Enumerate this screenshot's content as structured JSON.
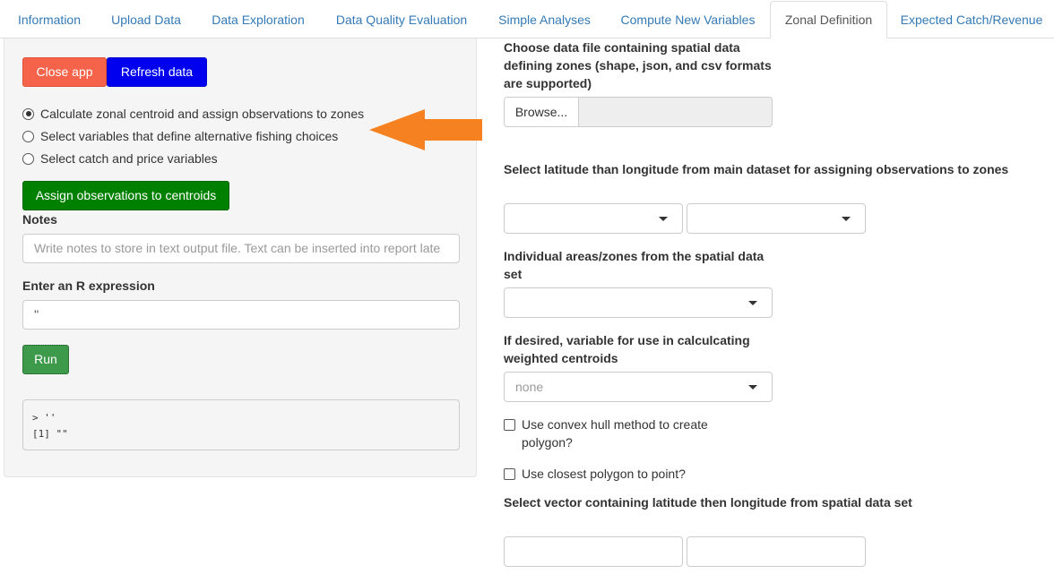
{
  "tabs": [
    {
      "label": "Information"
    },
    {
      "label": "Upload Data"
    },
    {
      "label": "Data Exploration"
    },
    {
      "label": "Data Quality Evaluation"
    },
    {
      "label": "Simple Analyses"
    },
    {
      "label": "Compute New Variables"
    },
    {
      "label": "Zonal Definition",
      "active": true
    },
    {
      "label": "Expected Catch/Revenue"
    }
  ],
  "sidebar": {
    "close_label": "Close app",
    "refresh_label": "Refresh data",
    "radio_options": [
      {
        "label": "Calculate zonal centroid and assign observations to zones",
        "selected": true
      },
      {
        "label": "Select variables that define alternative fishing choices",
        "selected": false
      },
      {
        "label": "Select catch and price variables",
        "selected": false
      }
    ],
    "assign_label": "Assign observations to centroids",
    "notes_label": "Notes",
    "notes_placeholder": "Write notes to store in text output file. Text can be inserted into report late",
    "r_expr_label": "Enter an R expression",
    "r_expr_value": "''",
    "run_label": "Run",
    "console_output": "> ''\n[1] \"\""
  },
  "main": {
    "file_label": "Choose data file containing spatial data defining zones (shape, json, and csv formats are supported)",
    "browse_label": "Browse...",
    "latlon_label": "Select latitude than longitude from main dataset for assigning observations to zones",
    "zones_label": "Individual areas/zones from the spatial data set",
    "weight_label": "If desired, variable for use in calculcating weighted centroids",
    "weight_value": "none",
    "convex_label": "Use convex hull method to create polygon?",
    "closest_label": "Use closest polygon to point?",
    "vector_label": "Select vector containing latitude then longitude from spatial data set"
  },
  "colors": {
    "close_button": "#f5644a",
    "refresh_button": "#0000ee",
    "assign_button": "#008000",
    "run_button": "#3d9a4b",
    "arrow": "#f68121",
    "tab_link": "#337ab7"
  }
}
